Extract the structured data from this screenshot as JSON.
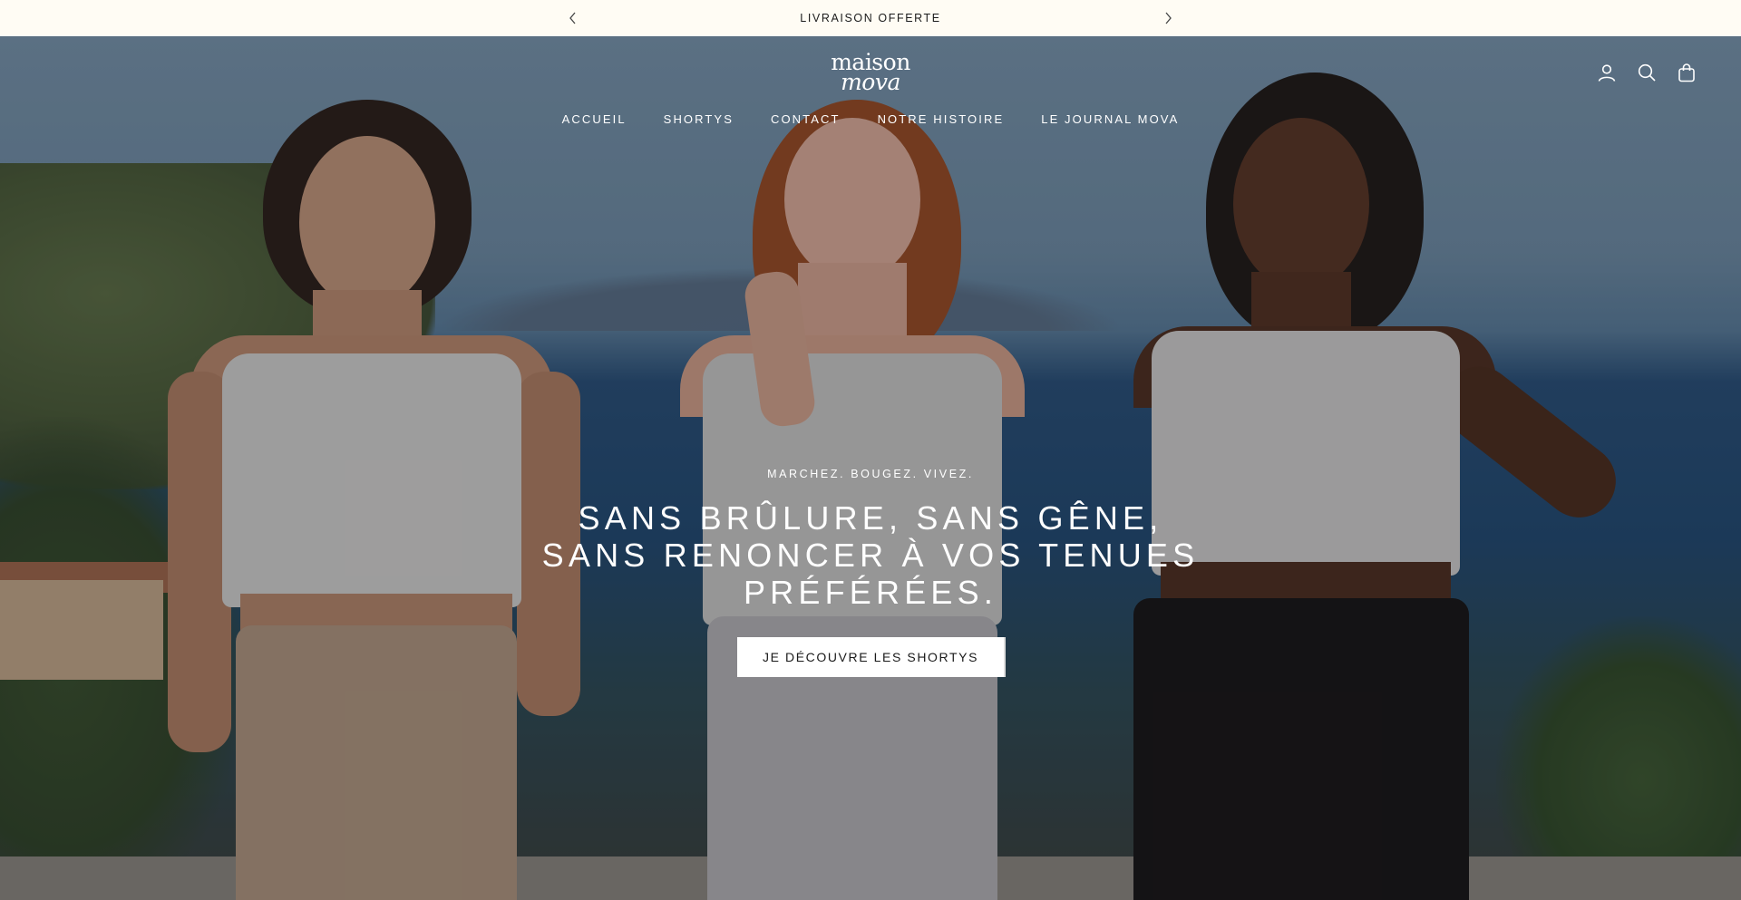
{
  "announcement": {
    "text": "LIVRAISON OFFERTE",
    "prev_icon": "chevron-left-icon",
    "next_icon": "chevron-right-icon"
  },
  "header": {
    "logo_line1": "maison",
    "logo_line2": "mova",
    "icons": [
      "account-icon",
      "search-icon",
      "bag-icon"
    ]
  },
  "nav": {
    "items": [
      "ACCUEIL",
      "SHORTYS",
      "CONTACT",
      "NOTRE HISTOIRE",
      "LE JOURNAL MOVA"
    ]
  },
  "hero": {
    "eyebrow": "MARCHEZ. BOUGEZ. VIVEZ.",
    "headline": "SANS BRÛLURE, SANS GÊNE, SANS RENONCER À VOS TENUES PRÉFÉRÉES.",
    "cta_label": "JE DÉCOUVRE LES SHORTYS"
  },
  "colors": {
    "announcement_bg": "#fffcf4",
    "text_light": "#ffffff",
    "text_dark": "#1c1c1c"
  }
}
